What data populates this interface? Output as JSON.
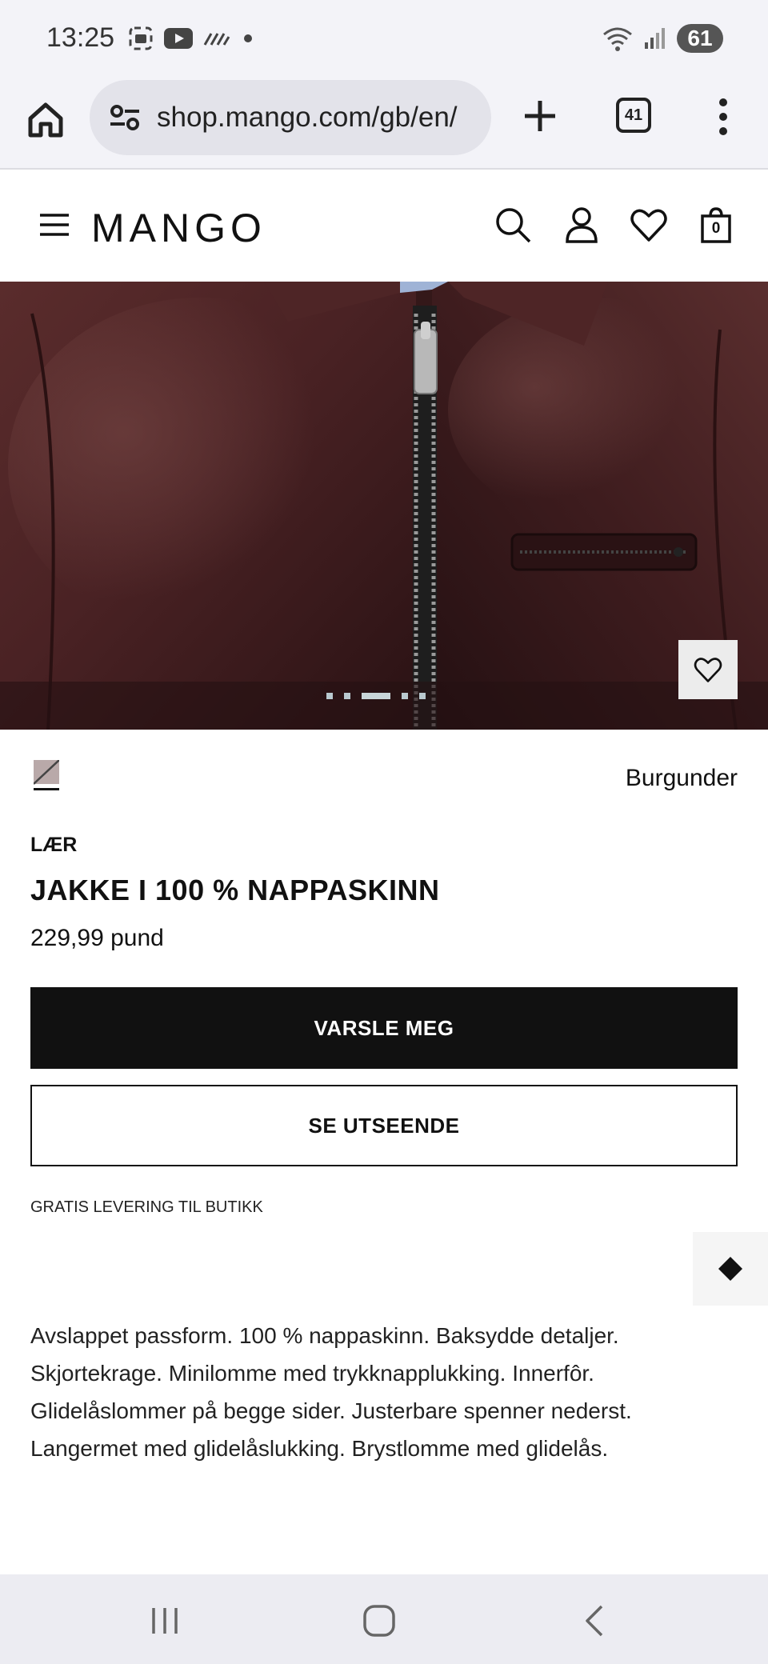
{
  "status_bar": {
    "time": "13:25",
    "battery": "61",
    "icons_left": [
      "screenshot-icon",
      "youtube-icon",
      "signal-dashes-icon",
      "dot-icon"
    ],
    "icons_right": [
      "wifi-icon",
      "cell-signal-icon",
      "battery-icon"
    ]
  },
  "browser": {
    "url": "shop.mango.com/gb/en/",
    "tab_count": "41",
    "icons": [
      "home-icon",
      "tune-icon",
      "plus-icon",
      "tabs-icon",
      "more-vert-icon"
    ]
  },
  "site_header": {
    "logo": "MANGO",
    "icons": [
      "menu-icon",
      "search-icon",
      "account-icon",
      "heart-icon",
      "bag-icon"
    ],
    "bag_count": "0"
  },
  "hero": {
    "image": "burgundy leather jacket closeup",
    "slide_count": 5,
    "active_slide": 3
  },
  "product": {
    "color_name": "Burgunder",
    "category": "LÆR",
    "title": "JAKKE I 100 % NAPPASKINN",
    "price": "229,99 pund",
    "primary_button": "VARSLE MEG",
    "secondary_button": "SE UTSEENDE",
    "delivery_note": "GRATIS LEVERING TIL BUTIKK",
    "description": "Avslappet passform. 100 % nappaskinn. Baksydde detaljer. Skjortekrage. Minilomme med trykknapplukking. Innerfôr. Glidelåslommer på begge sider. Justerbare spenner nederst. Langermet med glidelåslukking. Brystlomme med glidelås."
  },
  "colors": {
    "jacket": "#3d1b1c",
    "button_primary": "#111111",
    "status_bg": "#f3f3f8"
  },
  "nav_bar": {
    "icons": [
      "recents-icon",
      "home-nav-icon",
      "back-icon"
    ]
  }
}
